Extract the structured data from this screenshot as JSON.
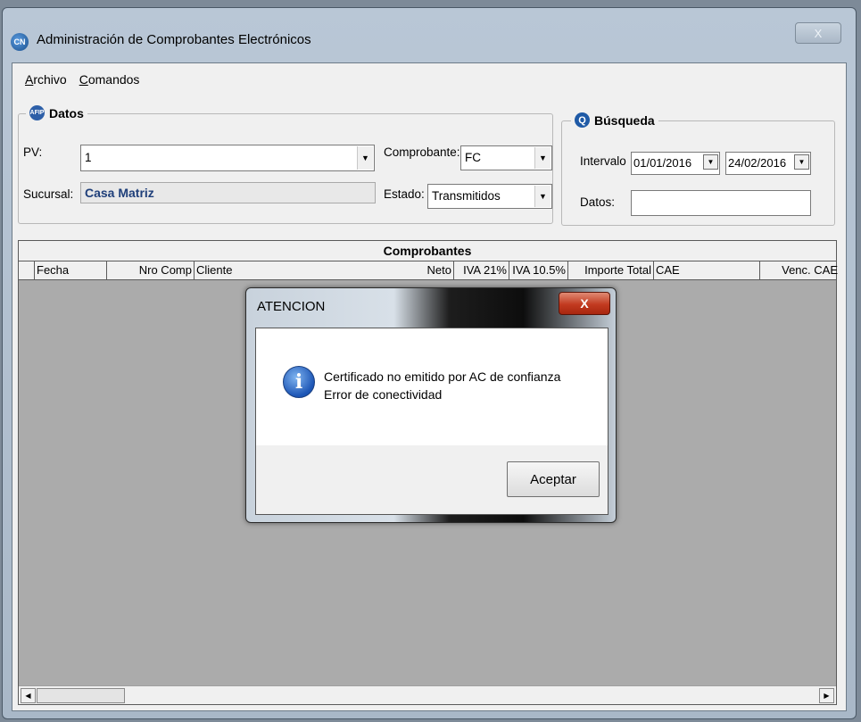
{
  "window": {
    "title": "Administración de Comprobantes Electrónicos",
    "icon": "app-logo-icon",
    "close_label": "X"
  },
  "menu": {
    "archivo": "Archivo",
    "comandos": "Comandos"
  },
  "datos": {
    "legend": "Datos",
    "pv_label": "PV:",
    "pv_value": "1",
    "sucursal_label": "Sucursal:",
    "sucursal_value": "Casa Matriz",
    "comprobante_label": "Comprobante:",
    "comprobante_value": "FC",
    "estado_label": "Estado:",
    "estado_value": "Transmitidos"
  },
  "busqueda": {
    "legend": "Búsqueda",
    "intervalo_label": "Intervalo",
    "fecha_desde": "01/01/2016",
    "fecha_hasta": "24/02/2016",
    "datos_label": "Datos:",
    "datos_value": ""
  },
  "grid": {
    "title": "Comprobantes",
    "columns": [
      "Fecha",
      "Nro Comp",
      "Cliente",
      "Neto",
      "IVA 21%",
      "IVA 10.5%",
      "Importe Total",
      "CAE",
      "Venc. CAE"
    ]
  },
  "dialog": {
    "title": "ATENCION",
    "close_label": "X",
    "message_line1": "Certificado no emitido por AC de confianza",
    "message_line2": "Error de conectividad",
    "ok_label": "Aceptar",
    "icon": "info-icon"
  },
  "colors": {
    "accent": "#1f3f7a",
    "dialog_close": "#c23b20"
  }
}
